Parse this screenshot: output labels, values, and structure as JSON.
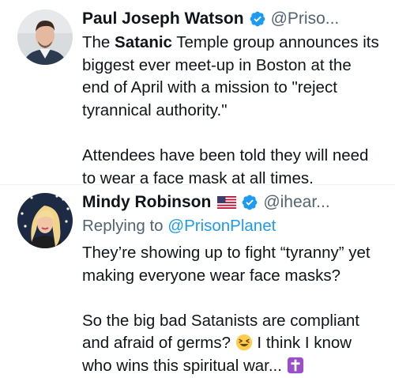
{
  "tweets": [
    {
      "name": "Paul Joseph Watson",
      "handle": "@Priso...",
      "text_parts": [
        "The ",
        "Satanic",
        " Temple group announces its\nbiggest ever meet-up in Boston at the\nend of April with a mission to \"reject\ntyrannical authority.\"\n\nAttendees have been told they will need\nto wear a face mask at all times."
      ]
    },
    {
      "name": "Mindy Robinson",
      "handle": "@ihear...",
      "reply_prefix": "Replying to ",
      "reply_to": "@PrisonPlanet",
      "text_a": "They’re showing up to fight “tyranny” yet\nmaking everyone wear face masks?\n\nSo the big bad Satanists are compliant\nand afraid of germs? ",
      "text_b": " I think I know\nwho wins this spiritual war... "
    }
  ],
  "icons": {
    "verified": "verified-badge-icon",
    "flag": "us-flag-icon",
    "laugh": "laughing-emoji-icon",
    "cross": "latin-cross-emoji-icon"
  },
  "colors": {
    "verified": "#1d9bf0",
    "link": "#1d9bf0",
    "secondary": "#536471",
    "cross_bg": "#9a4fc9"
  }
}
